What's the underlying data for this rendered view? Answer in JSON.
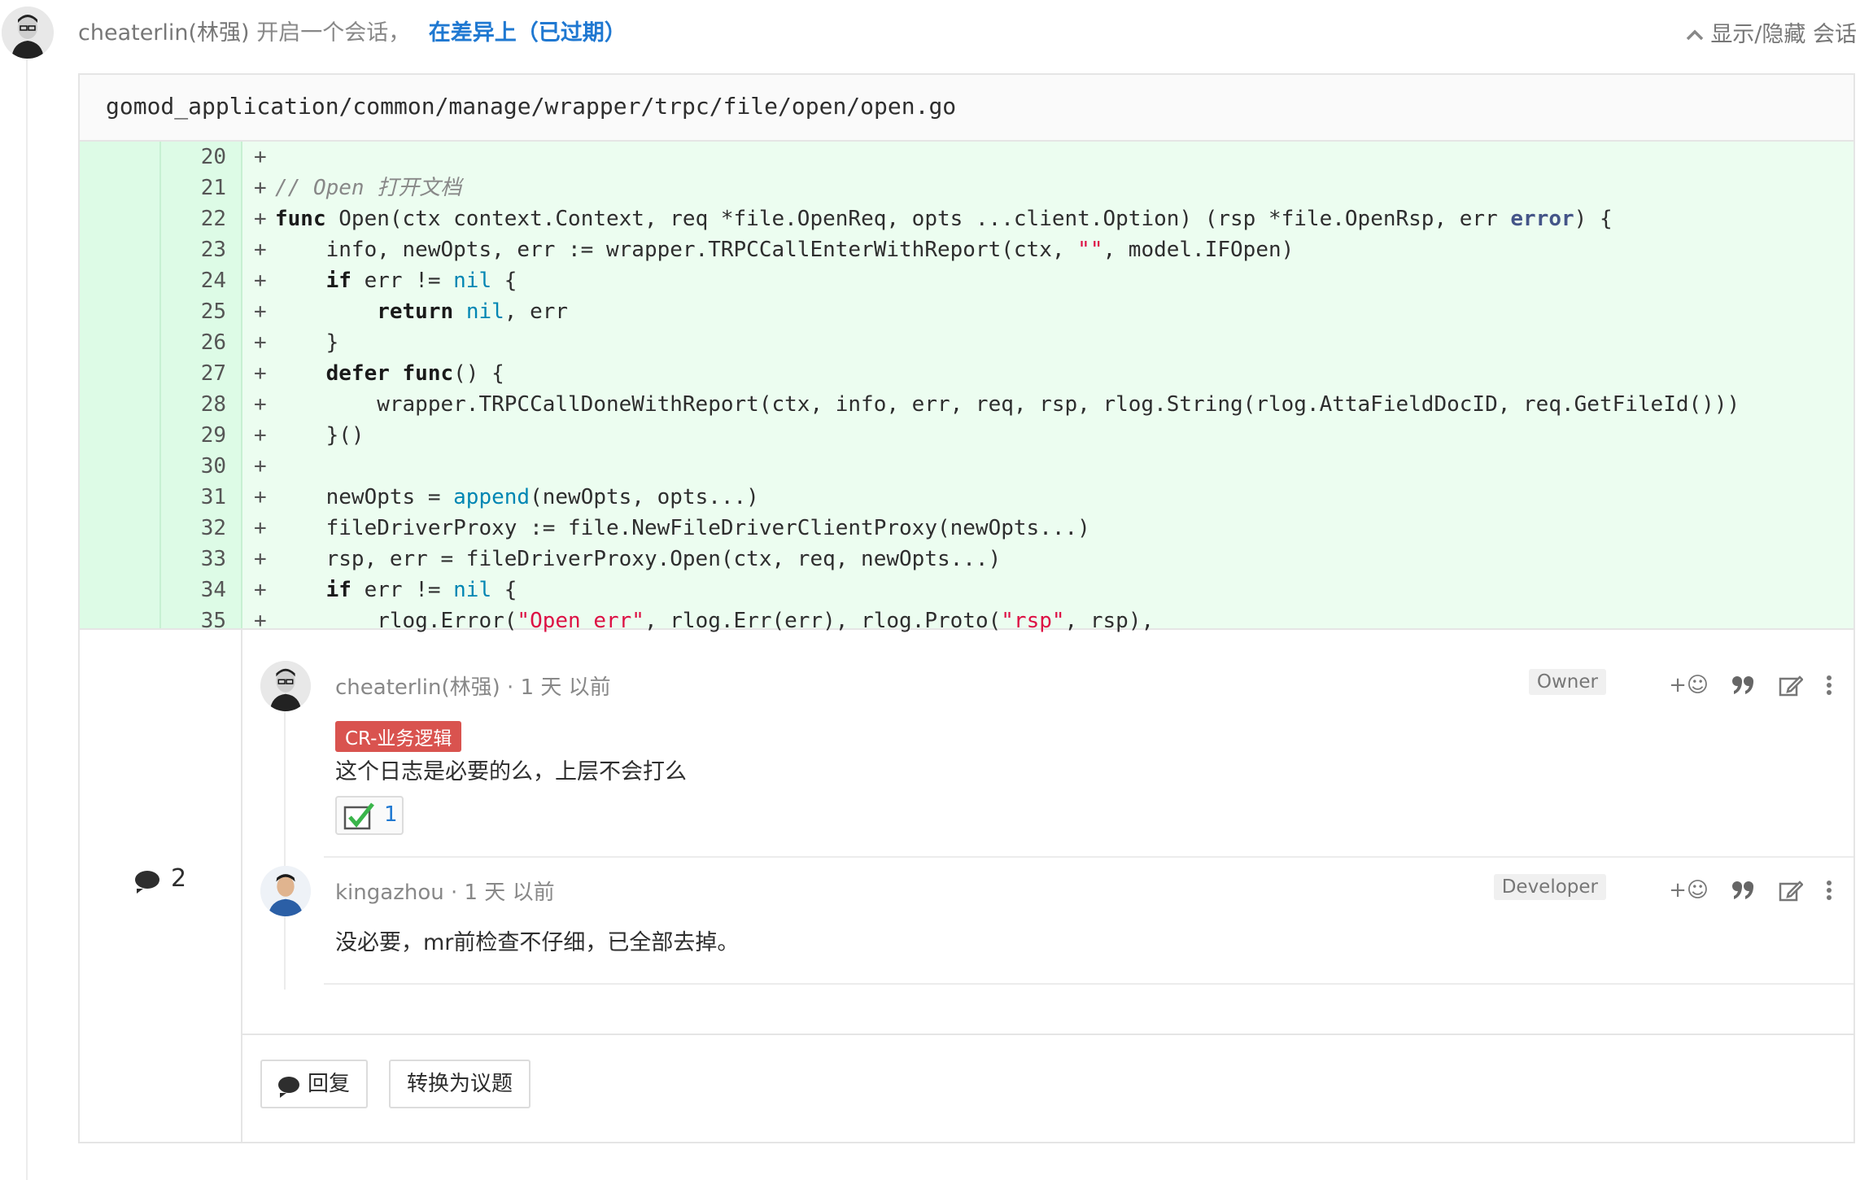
{
  "header": {
    "author": "cheaterlin(林强)",
    "action": "开启一个会话，",
    "context_link": "在差异上（已过期）",
    "toggle_label": "显示/隐藏 会话"
  },
  "file": {
    "path": "gomod_application/common/manage/wrapper/trpc/file/open/open.go"
  },
  "code_lines": [
    {
      "num": "20",
      "prefix": "+"
    },
    {
      "num": "21",
      "prefix": "+"
    },
    {
      "num": "22",
      "prefix": "+"
    },
    {
      "num": "23",
      "prefix": "+"
    },
    {
      "num": "24",
      "prefix": "+"
    },
    {
      "num": "25",
      "prefix": "+"
    },
    {
      "num": "26",
      "prefix": "+"
    },
    {
      "num": "27",
      "prefix": "+"
    },
    {
      "num": "28",
      "prefix": "+"
    },
    {
      "num": "29",
      "prefix": "+"
    },
    {
      "num": "30",
      "prefix": "+"
    },
    {
      "num": "31",
      "prefix": "+"
    },
    {
      "num": "32",
      "prefix": "+"
    },
    {
      "num": "33",
      "prefix": "+"
    },
    {
      "num": "34",
      "prefix": "+"
    },
    {
      "num": "35",
      "prefix": "+"
    }
  ],
  "code": {
    "l21_comment": "// Open 打开文档",
    "l22_func": "func",
    "l22_a": " Open(ctx context.Context, req *file.OpenReq, opts ...client.Option) (rsp *file.OpenRsp, err ",
    "l22_error": "error",
    "l22_b": ") {",
    "l23_a": "    info, newOpts, err := wrapper.TRPCCallEnterWithReport(ctx, ",
    "l23_str": "\"\"",
    "l23_b": ", model.IFOpen)",
    "l24_if": "    if",
    "l24_a": " err != ",
    "l24_nil": "nil",
    "l24_b": " {",
    "l25_return": "        return",
    "l25_sp": " ",
    "l25_nil": "nil",
    "l25_b": ", err",
    "l26": "    }",
    "l27_defer": "    defer func",
    "l27_b": "() {",
    "l28": "        wrapper.TRPCCallDoneWithReport(ctx, info, err, req, rsp, rlog.String(rlog.AttaFieldDocID, req.GetFileId()))",
    "l29": "    }()",
    "l31_a": "    newOpts = ",
    "l31_append": "append",
    "l31_b": "(newOpts, opts...)",
    "l32": "    fileDriverProxy := file.NewFileDriverClientProxy(newOpts...)",
    "l33": "    rsp, err = fileDriverProxy.Open(ctx, req, newOpts...)",
    "l34_if": "    if",
    "l34_a": " err != ",
    "l34_nil": "nil",
    "l34_b": " {",
    "l35_a": "        rlog.Error(",
    "l35_str1": "\"Open err\"",
    "l35_b": ", rlog.Err(err), rlog.Proto(",
    "l35_str2": "\"rsp\"",
    "l35_c": ", rsp),"
  },
  "discussion": {
    "note_count": "2",
    "notes": [
      {
        "author_time": "cheaterlin(林强) · 1 天 以前",
        "role": "Owner",
        "label": "CR-业务逻辑",
        "body": "这个日志是必要的么，上层不会打么",
        "award_count": "1"
      },
      {
        "author_time": "kingazhou · 1 天 以前",
        "role": "Developer",
        "body": "没必要，mr前检查不仔细，已全部去掉。"
      }
    ],
    "actions": {
      "emoji": "+☺",
      "quote": "❞"
    }
  },
  "reply_bar": {
    "reply_label": "回复",
    "convert_label": "转换为议题"
  },
  "colors": {
    "link": "#1f78d1",
    "added_bg": "#ecfdf0",
    "label_bg": "#d9534f"
  }
}
